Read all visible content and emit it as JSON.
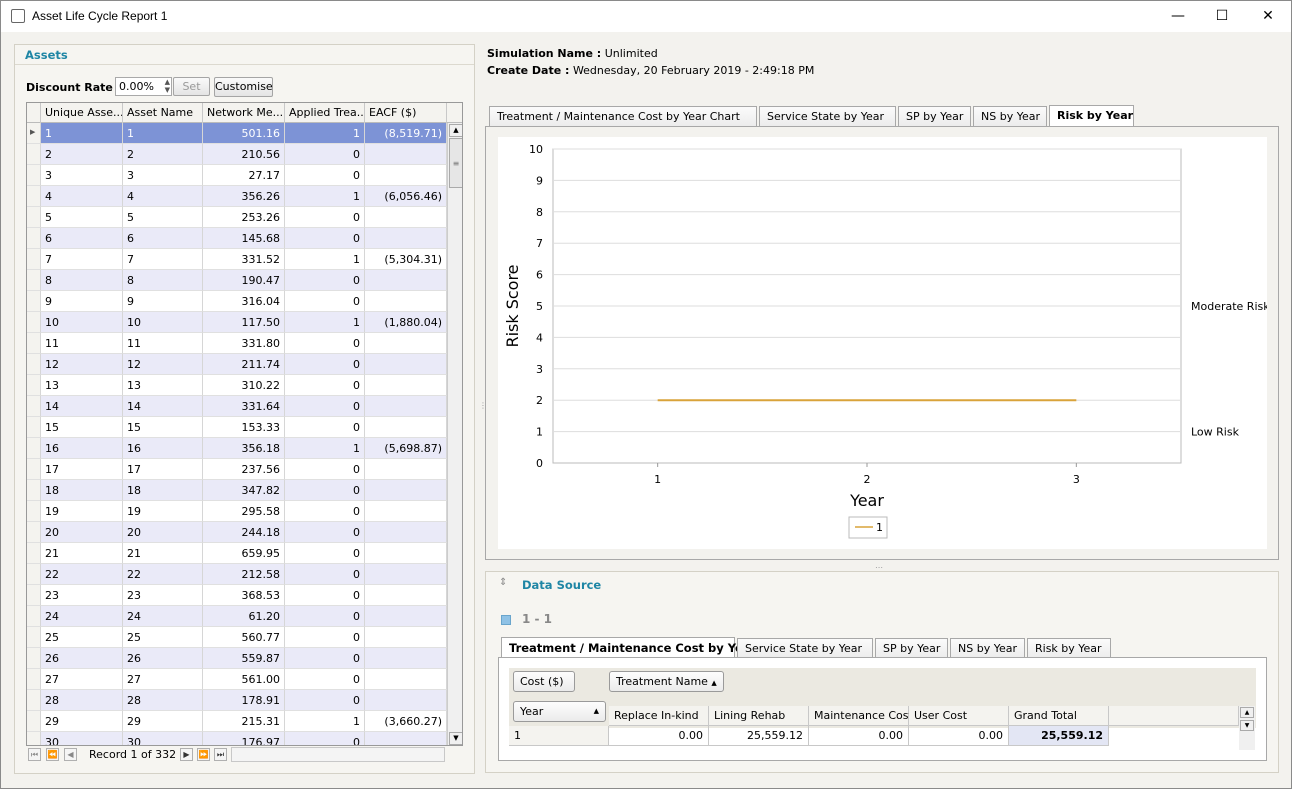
{
  "window": {
    "title": "Asset Life Cycle Report 1"
  },
  "assets": {
    "header": "Assets",
    "discount_label": "Discount Rate :",
    "discount_value": "0.00%",
    "set_label": "Set",
    "customise_label": "Customise",
    "columns": [
      "Unique Asse...",
      "Asset Name",
      "Network Me...",
      "Applied Trea...",
      "EACF ($)"
    ],
    "rows": [
      [
        "1",
        "1",
        "501.16",
        "1",
        "(8,519.71)"
      ],
      [
        "2",
        "2",
        "210.56",
        "0",
        ""
      ],
      [
        "3",
        "3",
        "27.17",
        "0",
        ""
      ],
      [
        "4",
        "4",
        "356.26",
        "1",
        "(6,056.46)"
      ],
      [
        "5",
        "5",
        "253.26",
        "0",
        ""
      ],
      [
        "6",
        "6",
        "145.68",
        "0",
        ""
      ],
      [
        "7",
        "7",
        "331.52",
        "1",
        "(5,304.31)"
      ],
      [
        "8",
        "8",
        "190.47",
        "0",
        ""
      ],
      [
        "9",
        "9",
        "316.04",
        "0",
        ""
      ],
      [
        "10",
        "10",
        "117.50",
        "1",
        "(1,880.04)"
      ],
      [
        "11",
        "11",
        "331.80",
        "0",
        ""
      ],
      [
        "12",
        "12",
        "211.74",
        "0",
        ""
      ],
      [
        "13",
        "13",
        "310.22",
        "0",
        ""
      ],
      [
        "14",
        "14",
        "331.64",
        "0",
        ""
      ],
      [
        "15",
        "15",
        "153.33",
        "0",
        ""
      ],
      [
        "16",
        "16",
        "356.18",
        "1",
        "(5,698.87)"
      ],
      [
        "17",
        "17",
        "237.56",
        "0",
        ""
      ],
      [
        "18",
        "18",
        "347.82",
        "0",
        ""
      ],
      [
        "19",
        "19",
        "295.58",
        "0",
        ""
      ],
      [
        "20",
        "20",
        "244.18",
        "0",
        ""
      ],
      [
        "21",
        "21",
        "659.95",
        "0",
        ""
      ],
      [
        "22",
        "22",
        "212.58",
        "0",
        ""
      ],
      [
        "23",
        "23",
        "368.53",
        "0",
        ""
      ],
      [
        "24",
        "24",
        "61.20",
        "0",
        ""
      ],
      [
        "25",
        "25",
        "560.77",
        "0",
        ""
      ],
      [
        "26",
        "26",
        "559.87",
        "0",
        ""
      ],
      [
        "27",
        "27",
        "561.00",
        "0",
        ""
      ],
      [
        "28",
        "28",
        "178.91",
        "0",
        ""
      ],
      [
        "29",
        "29",
        "215.31",
        "1",
        "(3,660.27)"
      ],
      [
        "30",
        "30",
        "176.97",
        "0",
        ""
      ]
    ],
    "record_text": "Record 1 of 332"
  },
  "simulation": {
    "name_label": "Simulation Name :",
    "name_value": "Unlimited",
    "date_label": "Create Date :",
    "date_value": "Wednesday, 20 February 2019 - 2:49:18 PM"
  },
  "chart_tabs": [
    "Treatment / Maintenance Cost by Year Chart",
    "Service State by Year",
    "SP by Year",
    "NS by Year",
    "Risk by Year"
  ],
  "chart_data": {
    "type": "line",
    "x": [
      1,
      2,
      3
    ],
    "series": [
      {
        "name": "1",
        "values": [
          2,
          2,
          2
        ]
      }
    ],
    "xlabel": "Year",
    "ylabel": "Risk Score",
    "ylim": [
      0,
      10
    ],
    "xticks": [
      "1",
      "2",
      "3"
    ],
    "yticks": [
      "0",
      "1",
      "2",
      "3",
      "4",
      "5",
      "6",
      "7",
      "8",
      "9",
      "10"
    ],
    "annotations": [
      {
        "label": "Moderate Risk",
        "y": 5
      },
      {
        "label": "Low Risk",
        "y": 1
      }
    ],
    "grid": true,
    "legend": "bottom-center",
    "color": "#d9a33a"
  },
  "datasource": {
    "header": "Data Source",
    "group_label": "1 - 1",
    "tabs": [
      "Treatment / Maintenance Cost by Year",
      "Service State by Year",
      "SP by Year",
      "NS by Year",
      "Risk by Year"
    ],
    "cost_field": "Cost ($)",
    "treatment_field": "Treatment Name",
    "year_field": "Year",
    "columns": [
      "Replace In-kind",
      "Lining Rehab",
      "Maintenance Cost",
      "User Cost",
      "Grand Total"
    ],
    "row": {
      "year": "1",
      "values": [
        "0.00",
        "25,559.12",
        "0.00",
        "0.00",
        "25,559.12"
      ]
    }
  }
}
